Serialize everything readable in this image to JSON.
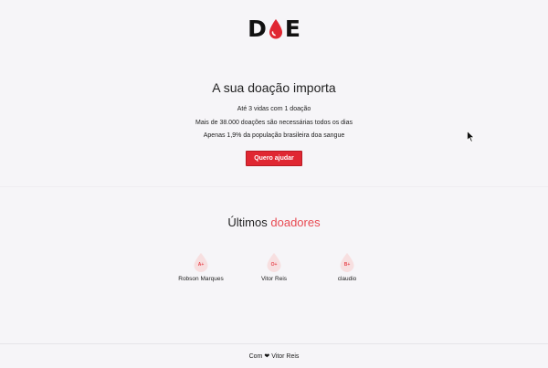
{
  "logo": {
    "left": "D",
    "right": "E",
    "drop_color": "#e02732"
  },
  "hero": {
    "title": "A sua doação importa",
    "lines": [
      "Até 3 vidas com 1 doação",
      "Mais de 38.000 doações são necessárias todos os dias",
      "Apenas 1,9% da população brasileira doa sangue"
    ],
    "button_label": "Quero ajudar"
  },
  "donors_section": {
    "title_main": "Últimos",
    "title_accent": "doadores",
    "donors": [
      {
        "blood_type": "A+",
        "name": "Robson Marques"
      },
      {
        "blood_type": "O+",
        "name": "Vitor Reis"
      },
      {
        "blood_type": "B+",
        "name": "claudio"
      }
    ]
  },
  "footer": {
    "prefix": "Com",
    "icon": "heart-icon",
    "author": "Vitor Reis"
  },
  "colors": {
    "accent": "#e84a52",
    "button": "#e02732",
    "background": "#f6f5f8"
  }
}
